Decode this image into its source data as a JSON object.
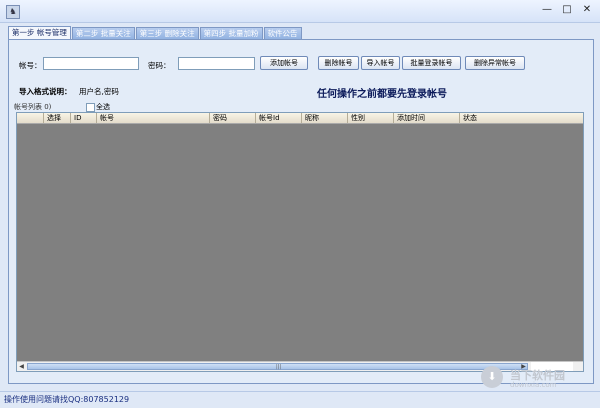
{
  "window": {
    "icon": "app-icon",
    "controls": [
      "—",
      "□",
      "✕"
    ]
  },
  "tabs": [
    {
      "label": "第一步 帐号管理",
      "active": true
    },
    {
      "label": "第二步 批量关注",
      "active": false
    },
    {
      "label": "第三步 删除关注",
      "active": false
    },
    {
      "label": "第四步 批量加粉",
      "active": false
    },
    {
      "label": "软件公告",
      "active": false
    }
  ],
  "form": {
    "account_label": "帐号：",
    "account_value": "",
    "password_label": "密码：",
    "password_value": ""
  },
  "buttons": {
    "add": "添加帐号",
    "delete": "删除帐号",
    "import": "导入帐号",
    "batch_login": "批量登录帐号",
    "delete_abnormal": "删除异常帐号"
  },
  "import_format": {
    "label": "导入格式说明：",
    "value": "用户名,密码"
  },
  "notice": "任何操作之前都要先登录帐号",
  "account_list": {
    "title": "帐号列表 0)",
    "select_all": "全选",
    "columns": [
      "选择",
      "ID",
      "帐号",
      "密码",
      "帐号Id",
      "昵称",
      "性别",
      "添加时间",
      "状态"
    ]
  },
  "status_bar": "操作使用问题请找QQ:807852129",
  "watermark": {
    "text": "当下软件园",
    "sub": "downxia.com",
    "logo": "down-arrow-icon"
  }
}
